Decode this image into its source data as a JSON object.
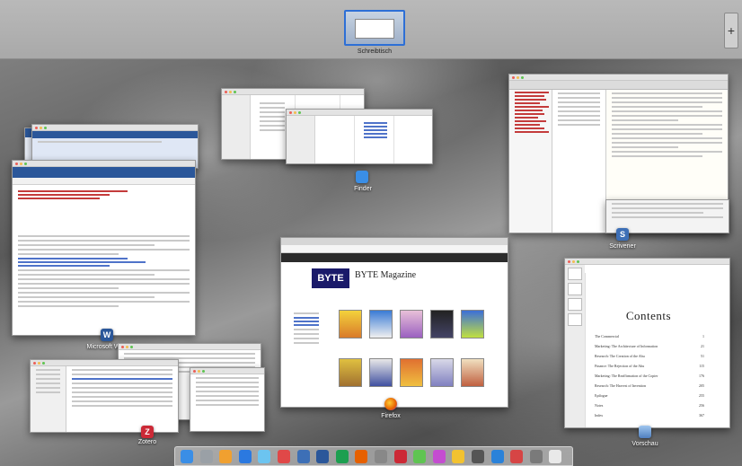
{
  "spaces_bar": {
    "space_label": "Schreibtisch",
    "add_space_symbol": "+"
  },
  "windows": {
    "word": {
      "label": "Microsoft Word",
      "icon_letter": "W",
      "icon_color": "#2b579a"
    },
    "finder": {
      "label": "Finder",
      "icon_color": "#3a8ee6"
    },
    "scrivener": {
      "label": "Scrivener",
      "icon_letter": "S",
      "icon_color": "#3d6fb6"
    },
    "firefox": {
      "label": "Firefox",
      "icon_color": "#e66000",
      "page_title": "BYTE Magazine",
      "logo_text": "BYTE"
    },
    "zotero": {
      "label": "Zotero",
      "icon_letter": "Z",
      "icon_color": "#cc2936"
    },
    "preview": {
      "label": "Vorschau",
      "contents_title": "Contents",
      "toc": [
        {
          "title": "The Commercial",
          "page": "1"
        },
        {
          "title": "Marketing: The Architecture of Information",
          "page": "21"
        },
        {
          "title": "Research: The Creation of the Abu",
          "page": "51"
        },
        {
          "title": "Finance: The Rejection of the Abu",
          "page": "115"
        },
        {
          "title": "Marketing: The Reaffirmation of the Copier",
          "page": "176"
        },
        {
          "title": "Research: The Harvest of Invention",
          "page": "205"
        },
        {
          "title": "Epilogue",
          "page": "255"
        },
        {
          "title": "Notes",
          "page": "256"
        },
        {
          "title": "Index",
          "page": "367"
        }
      ]
    }
  },
  "dock_colors": [
    "#3a8ee6",
    "#9aa0a6",
    "#f0a030",
    "#2b79e0",
    "#6cc4f0",
    "#e04848",
    "#3d6fb6",
    "#2b579a",
    "#1d9f50",
    "#e66000",
    "#888888",
    "#cc2936",
    "#5fc452",
    "#c44dd0",
    "#f2c230",
    "#555555",
    "#2b82d9",
    "#d64545",
    "#7a7a7a",
    "#e9e9e9"
  ]
}
